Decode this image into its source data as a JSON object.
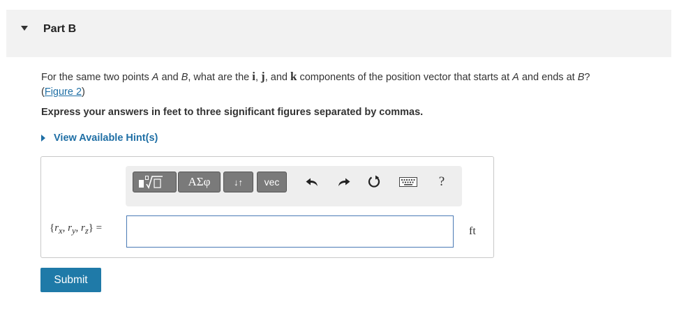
{
  "part": {
    "title": "Part B"
  },
  "question": {
    "text_1": "For the same two points ",
    "point_a": "A",
    "text_2": " and ",
    "point_b": "B",
    "text_3": ", what are the ",
    "unit_i": "i",
    "comma": ",",
    "unit_j": "j",
    "text_4": ", and ",
    "unit_k": "k",
    "text_5": " components of the position vector that starts at ",
    "point_a2": "A",
    "text_6": " and ends at ",
    "point_b2": "B",
    "text_7": "?",
    "figure_open": "(",
    "figure_link": "Figure 2",
    "figure_close": ")"
  },
  "instruction": "Express your answers in feet to three significant figures separated by commas.",
  "hint": {
    "label": "View Available Hint(s)"
  },
  "toolbar": {
    "greek_label": "ΑΣφ",
    "sort_label": "↓↑",
    "vec_label": "vec",
    "help_label": "?",
    "icons": {
      "template": "templates-icon",
      "undo": "undo-icon",
      "redo": "redo-icon",
      "reset": "reset-icon",
      "keyboard": "keyboard-icon"
    }
  },
  "answer": {
    "label_open": "{",
    "r": "r",
    "sub_x": "x",
    "sub_y": "y",
    "sub_z": "z",
    "sep": ", ",
    "label_close": "} =",
    "value": "",
    "unit": "ft"
  },
  "submit_label": "Submit",
  "colors": {
    "link": "#1f6fa5",
    "submit_bg": "#1f7aa8",
    "header_bg": "#f2f2f2",
    "toolbar_button": "#7a7a7a",
    "input_border": "#4a7ab5"
  }
}
